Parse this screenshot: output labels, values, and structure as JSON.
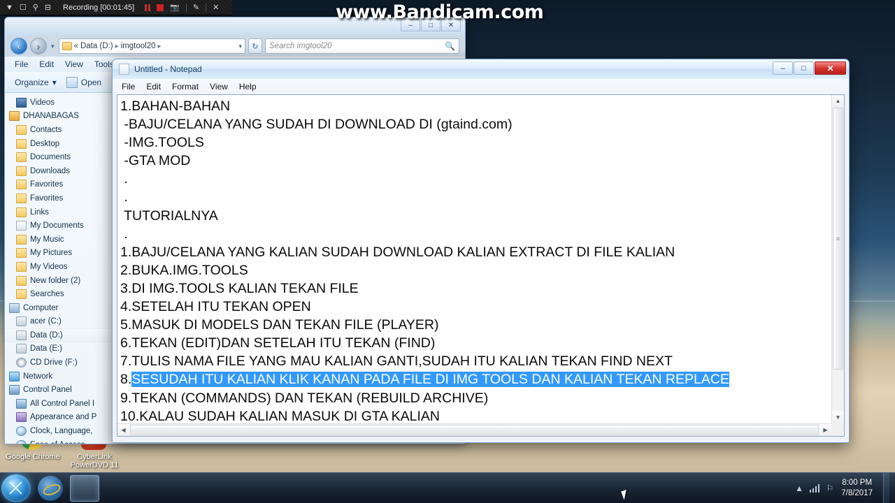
{
  "recorder": {
    "title": "Recording [00:01:45]",
    "icons": [
      "caret-down-icon",
      "window-icon",
      "magnifier-icon",
      "region-icon",
      "pause-icon",
      "stop-icon",
      "camera-icon",
      "pencil-icon",
      "close-icon"
    ]
  },
  "watermark": "www.Bandicam.com",
  "explorer": {
    "address": {
      "chevrons": "«",
      "crumbs": [
        "Data (D:)",
        "imgtool20"
      ],
      "separator": "▸",
      "dropdown": "▾",
      "refresh": "↻"
    },
    "search": {
      "placeholder": "Search imgtool20",
      "icon": "🔍"
    },
    "menu": [
      "File",
      "Edit",
      "View",
      "Tools"
    ],
    "toolbar": {
      "organize": "Organize",
      "organize_caret": "▾",
      "open": "Open"
    },
    "window_buttons": {
      "minimize": "–",
      "maximize": "□",
      "close": "✕"
    },
    "nav_back": "‹",
    "nav_forward": "›",
    "tree": [
      {
        "label": "Videos",
        "icon": "video-icon",
        "indent": 1,
        "selected": false
      },
      {
        "label": "DHANABAGAS",
        "icon": "user-icon",
        "indent": 0,
        "selected": false
      },
      {
        "label": "Contacts",
        "icon": "folder-icon",
        "indent": 1,
        "selected": false
      },
      {
        "label": "Desktop",
        "icon": "folder-icon",
        "indent": 1,
        "selected": false
      },
      {
        "label": "Documents",
        "icon": "folder-icon",
        "indent": 1,
        "selected": false
      },
      {
        "label": "Downloads",
        "icon": "folder-icon",
        "indent": 1,
        "selected": false
      },
      {
        "label": "Favorites",
        "icon": "folder-icon",
        "indent": 1,
        "selected": false
      },
      {
        "label": "Favorites",
        "icon": "folder-icon",
        "indent": 1,
        "selected": false
      },
      {
        "label": "Links",
        "icon": "folder-icon",
        "indent": 1,
        "selected": false
      },
      {
        "label": "My Documents",
        "icon": "doc-icon",
        "indent": 1,
        "selected": false
      },
      {
        "label": "My Music",
        "icon": "folder-icon",
        "indent": 1,
        "selected": false
      },
      {
        "label": "My Pictures",
        "icon": "folder-icon",
        "indent": 1,
        "selected": false
      },
      {
        "label": "My Videos",
        "icon": "folder-icon",
        "indent": 1,
        "selected": false
      },
      {
        "label": "New folder (2)",
        "icon": "folder-icon",
        "indent": 1,
        "selected": false
      },
      {
        "label": "Searches",
        "icon": "folder-icon",
        "indent": 1,
        "selected": false
      },
      {
        "label": "Computer",
        "icon": "computer-icon",
        "indent": 0,
        "selected": false
      },
      {
        "label": "acer (C:)",
        "icon": "drive-icon",
        "indent": 1,
        "selected": false
      },
      {
        "label": "Data (D:)",
        "icon": "drive-icon",
        "indent": 1,
        "selected": true
      },
      {
        "label": "Data (E:)",
        "icon": "drive-icon",
        "indent": 1,
        "selected": false
      },
      {
        "label": "CD Drive (F:)",
        "icon": "cd-drive-icon",
        "indent": 1,
        "selected": false
      },
      {
        "label": "Network",
        "icon": "network-icon",
        "indent": 0,
        "selected": false
      },
      {
        "label": "Control Panel",
        "icon": "control-panel-icon",
        "indent": 0,
        "selected": false
      },
      {
        "label": "All Control Panel I",
        "icon": "control-panel-icon",
        "indent": 1,
        "selected": false
      },
      {
        "label": "Appearance and P",
        "icon": "appearance-icon",
        "indent": 1,
        "selected": false
      },
      {
        "label": "Clock, Language,",
        "icon": "clock-icon",
        "indent": 1,
        "selected": false
      },
      {
        "label": "Ease of Access",
        "icon": "ease-of-access-icon",
        "indent": 1,
        "selected": false
      }
    ]
  },
  "notepad": {
    "title": "Untitled - Notepad",
    "menu": [
      "File",
      "Edit",
      "Format",
      "View",
      "Help"
    ],
    "window_buttons": {
      "minimize": "–",
      "maximize": "□",
      "close": "✕"
    },
    "lines": [
      {
        "text": "1.BAHAN-BAHAN",
        "selected": false
      },
      {
        "text": " -BAJU/CELANA YANG SUDAH DI DOWNLOAD DI (gtaind.com)",
        "selected": false
      },
      {
        "text": " -IMG.TOOLS",
        "selected": false
      },
      {
        "text": " -GTA MOD",
        "selected": false
      },
      {
        "text": " .",
        "selected": false
      },
      {
        "text": " .",
        "selected": false
      },
      {
        "text": " TUTORIALNYA",
        "selected": false
      },
      {
        "text": " .",
        "selected": false
      },
      {
        "text": "1.BAJU/CELANA YANG KALIAN SUDAH DOWNLOAD KALIAN EXTRACT DI FILE KALIAN",
        "selected": false
      },
      {
        "text": "2.BUKA.IMG.TOOLS",
        "selected": false
      },
      {
        "text": "3.DI IMG.TOOLS KALIAN TEKAN FILE",
        "selected": false
      },
      {
        "text": "4.SETELAH ITU TEKAN OPEN",
        "selected": false
      },
      {
        "text": "5.MASUK DI MODELS DAN TEKAN FILE (PLAYER)",
        "selected": false
      },
      {
        "text": "6.TEKAN (EDIT)DAN SETELAH ITU TEKAN (FIND)",
        "selected": false
      },
      {
        "text": "7.TULIS NAMA FILE YANG MAU KALIAN GANTI,SUDAH ITU KALIAN TEKAN FIND NEXT",
        "selected": false
      },
      {
        "prefix": "8.",
        "text": "SESUDAH ITU KALIAN KLIK KANAN PADA FILE DI IMG TOOLS DAN KALIAN TEKAN REPLACE",
        "selected": true
      },
      {
        "text": "9.TEKAN (COMMANDS) DAN TEKAN (REBUILD ARCHIVE)",
        "selected": false
      },
      {
        "text": "10.KALAU SUDAH KALIAN MASUK DI GTA KALIAN",
        "selected": false
      }
    ],
    "selection_color": "#3399ff"
  },
  "desktop_icons": [
    {
      "label": "Google Chrome",
      "icon": "chrome-icon"
    },
    {
      "label": "CyberLink PowerDVD 11",
      "icon": "powerdvd-icon"
    }
  ],
  "taskbar": {
    "start": "start-orb-icon",
    "quick_launch": [
      "internet-explorer-icon"
    ],
    "buttons": [
      {
        "name": "windows-explorer",
        "icon": "explorer-icon",
        "active": true
      },
      {
        "name": "microsoft-word",
        "icon": "word-icon",
        "active": false
      },
      {
        "name": "media-player",
        "icon": "obs-icon",
        "active": false
      },
      {
        "name": "screenshot-crop-tool",
        "icon": "crop-icon",
        "active": false
      },
      {
        "name": "chromium-browser",
        "icon": "chromium-icon",
        "active": false
      },
      {
        "name": "google-chrome",
        "icon": "chrome-icon",
        "active": false
      },
      {
        "name": "mozilla-firefox",
        "icon": "firefox-icon",
        "active": false
      },
      {
        "name": "winrar",
        "icon": "winrar-icon",
        "active": false
      },
      {
        "name": "uc-browser",
        "icon": "uc-icon",
        "active": false
      },
      {
        "name": "notepad",
        "icon": "notepad-icon",
        "active": false
      },
      {
        "name": "opera-browser",
        "icon": "opera-icon",
        "active": false
      },
      {
        "name": "video-editor",
        "icon": "filmora-icon",
        "active": false
      },
      {
        "name": "vlc-media-player",
        "icon": "vlc-icon",
        "active": false
      },
      {
        "name": "img-tool",
        "icon": "imgtool-icon",
        "active": false
      }
    ],
    "tray": {
      "show_hidden": "▲",
      "network": "signal-bars-icon",
      "action_center": "flag-icon"
    },
    "clock": {
      "time": "8:00 PM",
      "date": "7/8/2017"
    }
  }
}
